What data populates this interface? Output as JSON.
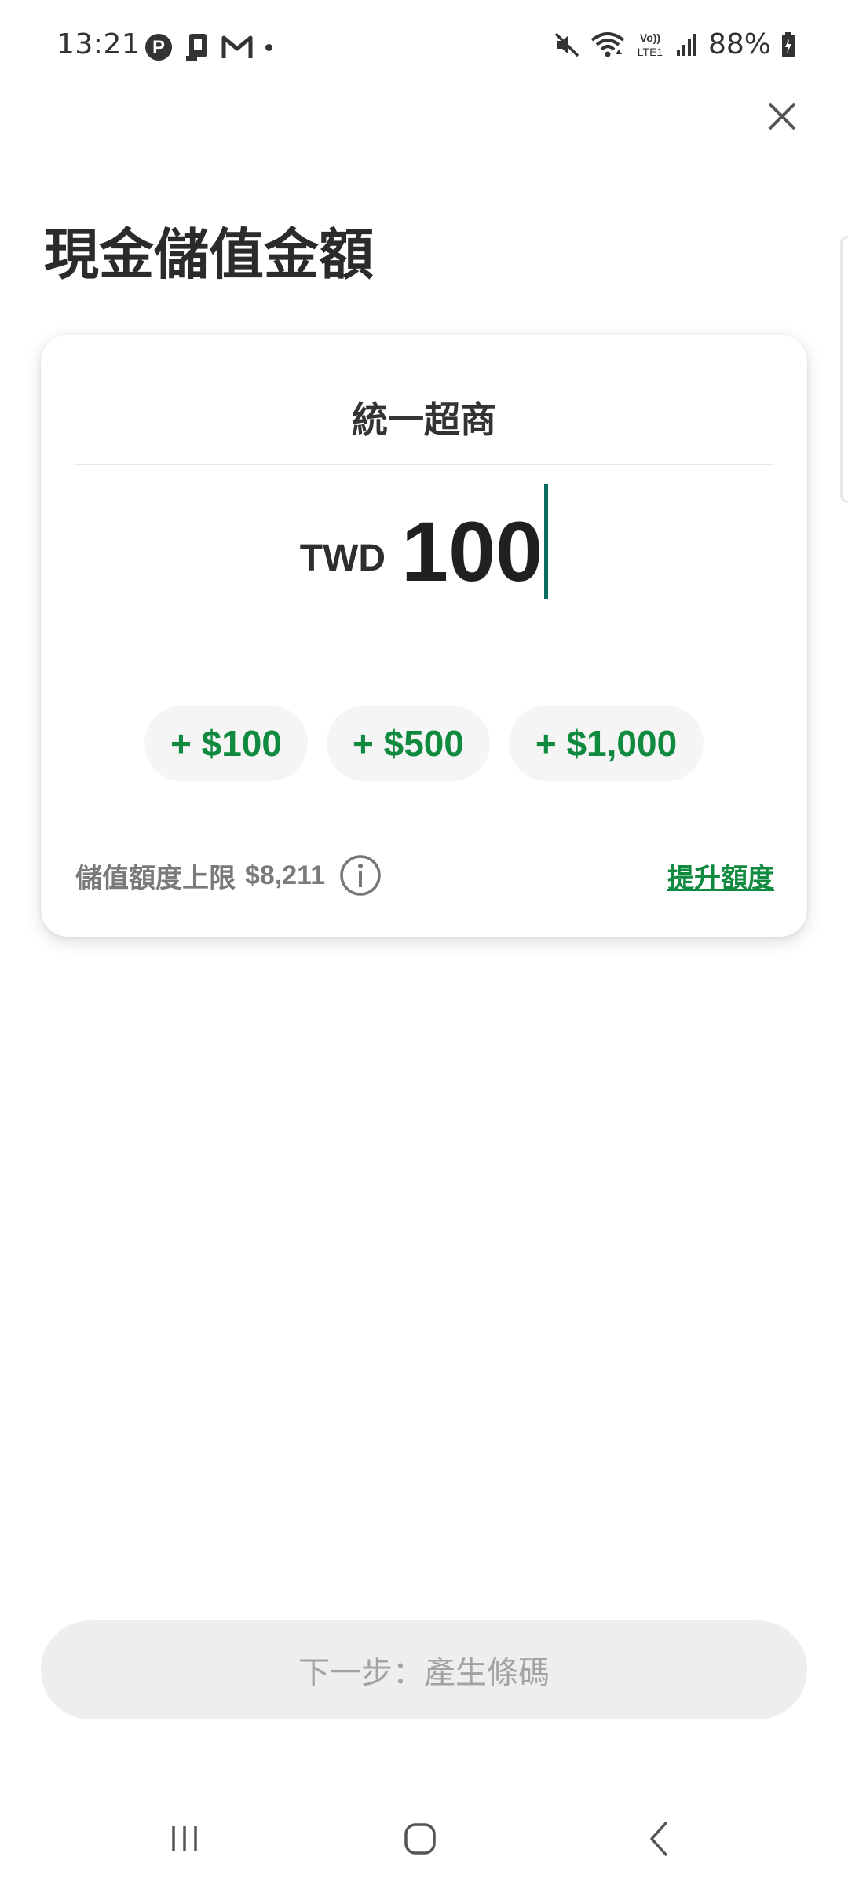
{
  "status_bar": {
    "time": "13:21",
    "left_icons": [
      "parking-icon",
      "device-icon",
      "mail-icon"
    ],
    "right_icons": [
      "mute-icon",
      "wifi-icon",
      "volte-icon",
      "signal-icon",
      "battery-icon"
    ],
    "volte_text": "Vo)) LTE1",
    "battery": "88%"
  },
  "header": {
    "title": "現金儲值金額",
    "close_icon": "close-icon"
  },
  "card": {
    "store_name": "統一超商",
    "currency": "TWD",
    "amount": "100",
    "quick_add": [
      {
        "label": "+ $100"
      },
      {
        "label": "+ $500"
      },
      {
        "label": "+ $1,000"
      }
    ],
    "limit_label": "儲值額度上限",
    "limit_value": "$8,211",
    "info_icon": "info-icon",
    "upgrade_label": "提升額度"
  },
  "footer": {
    "next_label": "下一步：產生條碼"
  },
  "nav": {
    "icons": [
      "recent-apps-icon",
      "home-icon",
      "back-icon"
    ]
  },
  "colors": {
    "accent_green": "#0f8a3f",
    "caret": "#0a6e64",
    "button_disabled_bg": "#eeeeee",
    "button_disabled_text": "#a3a3a3"
  }
}
